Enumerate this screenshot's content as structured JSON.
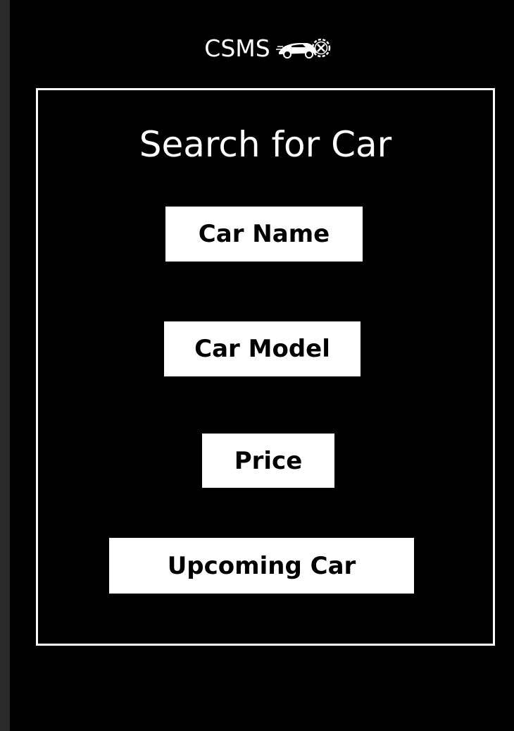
{
  "header": {
    "app_title": "CSMS",
    "logo_icon": "car-wrench-gear-icon"
  },
  "panel": {
    "title": "Search for Car",
    "buttons": [
      {
        "label": "Car Name"
      },
      {
        "label": "Car Model"
      },
      {
        "label": "Price"
      },
      {
        "label": "Upcoming Car"
      }
    ]
  },
  "colors": {
    "background": "#000000",
    "outer_frame": "#2a2a2a",
    "text": "#ffffff",
    "button_bg": "#ffffff",
    "button_text": "#000000"
  }
}
